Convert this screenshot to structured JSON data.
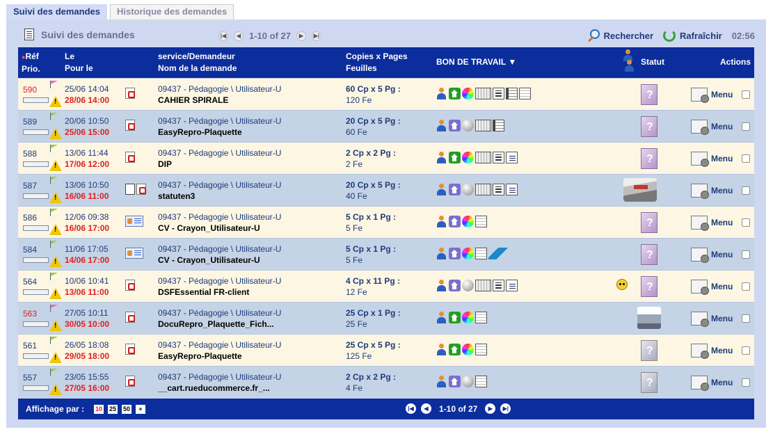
{
  "tabs": [
    {
      "label": "Suivi des demandes",
      "active": true
    },
    {
      "label": "Historique des demandes",
      "active": false
    }
  ],
  "toolbar": {
    "title": "Suivi des demandes",
    "pager": "1-10 of 27",
    "search_label": "Rechercher",
    "refresh_label": "Rafraîchir",
    "time": "02:56"
  },
  "header": {
    "ref": "Réf",
    "prio": "Prio.",
    "le": "Le",
    "pour_le": "Pour le",
    "service": "service/Demandeur",
    "nom": "Nom de la demande",
    "copies": "Copies x Pages",
    "feuilles": "Feuilles",
    "bon": "BON DE TRAVAIL ▼",
    "statut": "Statut",
    "actions": "Actions"
  },
  "rows": [
    {
      "ref": "590",
      "ref_red": true,
      "progress": 0.15,
      "flag": "#e66bd8",
      "le": "25/06 14:04",
      "pour_le": "28/06 14:00",
      "file": "pdf",
      "service": "09437 - Pédagogie \\ Utilisateur-U",
      "nom": "CAHIER SPIRALE",
      "copies": "60 Cp x 5 Pg :",
      "feuilles": "120 Fe",
      "icons": [
        "person",
        "home-green",
        "color",
        "book",
        "grid",
        "bind",
        "lines"
      ],
      "status": "question",
      "menu": "Menu"
    },
    {
      "ref": "589",
      "ref_red": false,
      "progress": 0.15,
      "flag": "#8fd445",
      "le": "20/06 10:50",
      "pour_le": "25/06 15:00",
      "file": "pdf",
      "service": "09437 - Pédagogie \\ Utilisateur-U",
      "nom": "EasyRepro-Plaquette",
      "copies": "20 Cp x 5 Pg :",
      "feuilles": "60 Fe",
      "icons": [
        "person",
        "home-purple",
        "gray",
        "book",
        "bind"
      ],
      "status": "question",
      "menu": "Menu"
    },
    {
      "ref": "588",
      "ref_red": false,
      "progress": 0.15,
      "flag": "#8fd445",
      "le": "13/06 11:44",
      "pour_le": "17/06 12:00",
      "file": "pdf",
      "service": "09437 - Pédagogie \\ Utilisateur-U",
      "nom": "DIP",
      "copies": "2 Cp x 2 Pg :",
      "feuilles": "2 Fe",
      "icons": [
        "person",
        "home-green",
        "color",
        "book",
        "grid",
        "staple"
      ],
      "status": "question",
      "menu": "Menu"
    },
    {
      "ref": "587",
      "ref_red": false,
      "progress": 0.6,
      "flag": "#8fd445",
      "le": "13/06 10:50",
      "pour_le": "16/06 11:00",
      "file": "stack-pdf",
      "service": "09437 - Pédagogie \\ Utilisateur-U",
      "nom": "statuten3",
      "copies": "20 Cp x 5 Pg :",
      "feuilles": "40 Fe",
      "icons": [
        "person",
        "home-purple",
        "gray",
        "book",
        "grid",
        "staple"
      ],
      "status": "machine",
      "menu": "Menu"
    },
    {
      "ref": "586",
      "ref_red": false,
      "progress": 0.15,
      "flag": "#8fd445",
      "le": "12/06 09:38",
      "pour_le": "16/06 17:00",
      "file": "card",
      "service": "09437 - Pédagogie \\ Utilisateur-U",
      "nom": "CV - Crayon_Utilisateur-U",
      "copies": "5 Cp x 1 Pg :",
      "feuilles": "5 Fe",
      "icons": [
        "person",
        "home-purple",
        "color",
        "lines"
      ],
      "status": "question",
      "menu": "Menu"
    },
    {
      "ref": "584",
      "ref_red": false,
      "progress": 0.15,
      "flag": "#8fd445",
      "le": "11/06 17:05",
      "pour_le": "14/06 17:00",
      "file": "card",
      "service": "09437 - Pédagogie \\ Utilisateur-U",
      "nom": "CV - Crayon_Utilisateur-U",
      "copies": "5 Cp x 1 Pg :",
      "feuilles": "5 Fe",
      "icons": [
        "person",
        "home-purple",
        "color",
        "lines",
        "laminate"
      ],
      "status": "question",
      "menu": "Menu"
    },
    {
      "ref": "564",
      "ref_red": false,
      "progress": 0.15,
      "flag": "#8fd445",
      "le": "10/06 10:41",
      "pour_le": "13/06 11:00",
      "file": "pdf",
      "service": "09437 - Pédagogie \\ Utilisateur-U",
      "nom": "DSFEssential FR-client",
      "copies": "4 Cp x 11 Pg :",
      "feuilles": "12 Fe",
      "icons": [
        "person",
        "home-purple",
        "gray",
        "book",
        "grid",
        "staple"
      ],
      "status": "question",
      "face": true,
      "menu": "Menu"
    },
    {
      "ref": "563",
      "ref_red": true,
      "progress": 0.0,
      "flag": "#e66bd8",
      "le": "27/05 10:11",
      "pour_le": "30/05 10:00",
      "file": "pdf",
      "service": "09437 - Pédagogie \\ Utilisateur-U",
      "nom": "DocuRepro_Plaquette_Fich...",
      "copies": "25 Cp x 1 Pg :",
      "feuilles": "25 Fe",
      "icons": [
        "person",
        "home-green",
        "color",
        "lines"
      ],
      "status": "printer",
      "menu": "Menu"
    },
    {
      "ref": "561",
      "ref_red": false,
      "progress": 0.15,
      "flag": "#8fd445",
      "le": "26/05 18:08",
      "pour_le": "29/05 18:00",
      "file": "pdf",
      "service": "09437 - Pédagogie \\ Utilisateur-U",
      "nom": "EasyRepro-Plaquette",
      "copies": "25 Cp x 5 Pg :",
      "feuilles": "125 Fe",
      "icons": [
        "person",
        "home-green",
        "color",
        "lines"
      ],
      "status": "question-gray",
      "menu": "Menu"
    },
    {
      "ref": "557",
      "ref_red": false,
      "progress": 0.15,
      "flag": "#8fd445",
      "le": "23/05 15:55",
      "pour_le": "27/05 16:00",
      "file": "pdf",
      "service": "09437 - Pédagogie \\ Utilisateur-U",
      "nom": "__cart.rueducommerce.fr_...",
      "copies": "2 Cp x 2 Pg :",
      "feuilles": "4 Fe",
      "icons": [
        "person",
        "home-purple",
        "gray",
        "lines"
      ],
      "status": "question-gray",
      "menu": "Menu"
    }
  ],
  "footer": {
    "affichage_label": "Affichage par :",
    "per_page": [
      "10",
      "25",
      "50",
      "+"
    ],
    "pager": "1-10 of 27"
  }
}
